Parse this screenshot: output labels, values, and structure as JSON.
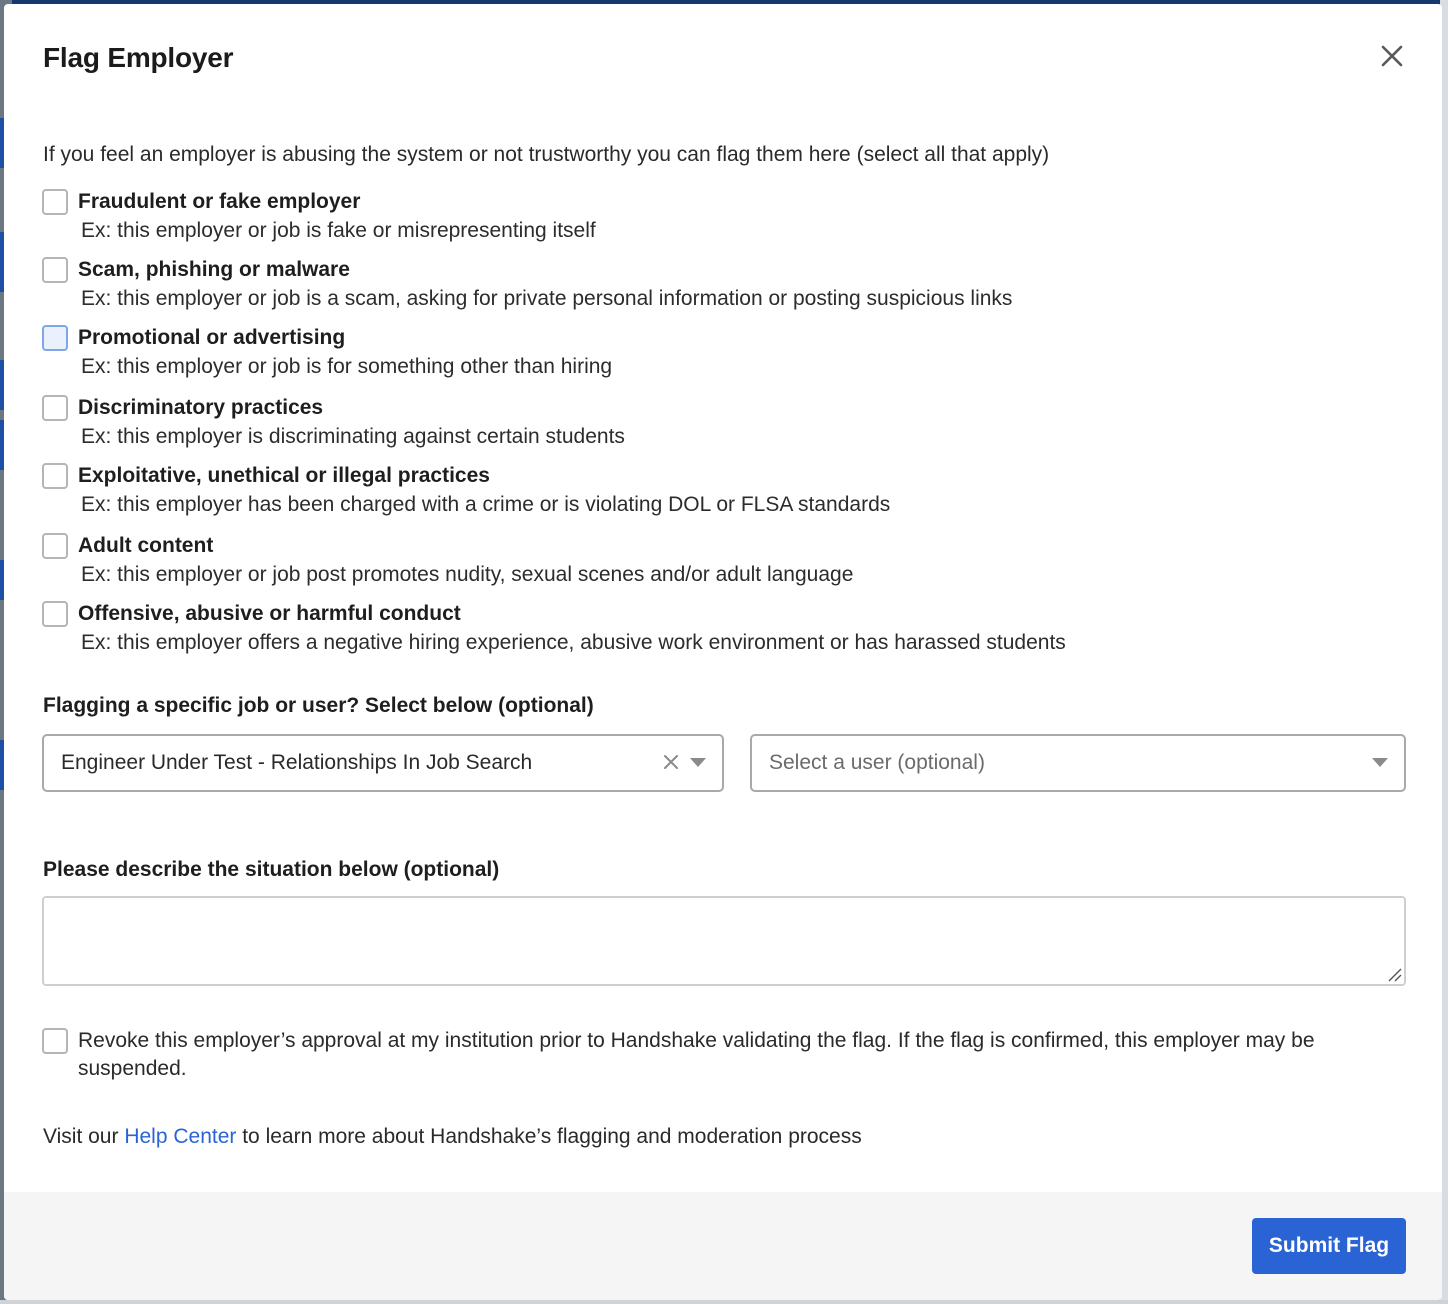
{
  "modal": {
    "title": "Flag Employer",
    "intro": "If you feel an employer is abusing the system or not trustworthy you can flag them here (select all that apply)"
  },
  "options": [
    {
      "title": "Fraudulent or fake employer",
      "desc": "Ex: this employer or job is fake or misrepresenting itself",
      "checked": false
    },
    {
      "title": "Scam, phishing or malware",
      "desc": "Ex: this employer or job is a scam, asking for private personal information or posting suspicious links",
      "checked": false
    },
    {
      "title": "Promotional or advertising",
      "desc": "Ex: this employer or job is for something other than hiring",
      "checked": false
    },
    {
      "title": "Discriminatory practices",
      "desc": "Ex: this employer is discriminating against certain students",
      "checked": false
    },
    {
      "title": "Exploitative, unethical or illegal practices",
      "desc": "Ex: this employer has been charged with a crime or is violating DOL or FLSA standards",
      "checked": false
    },
    {
      "title": "Adult content",
      "desc": "Ex: this employer or job post promotes nudity, sexual scenes and/or adult language",
      "checked": false
    },
    {
      "title": "Offensive, abusive or harmful conduct",
      "desc": "Ex: this employer offers a negative hiring experience, abusive work environment or has harassed students",
      "checked": false
    }
  ],
  "specific": {
    "label": "Flagging a specific job or user? Select below (optional)",
    "job_select_value": "Engineer Under Test - Relationships In Job Search",
    "user_select_placeholder": "Select a user (optional)"
  },
  "describe": {
    "label": "Please describe the situation below (optional)",
    "value": ""
  },
  "revoke": {
    "text": "Revoke this employer’s approval at my institution prior to Handshake validating the flag. If the flag is confirmed, this employer may be suspended.",
    "checked": false
  },
  "help": {
    "prefix": "Visit our ",
    "link": "Help Center",
    "suffix": " to learn more about Handshake’s flagging and moderation process"
  },
  "footer": {
    "submit_label": "Submit Flag"
  },
  "colors": {
    "accent": "#2a64d4",
    "footer_bg": "#f5f5f5"
  },
  "icons": {
    "close": "close-icon",
    "clear": "clear-icon",
    "caret": "chevron-down-icon"
  }
}
